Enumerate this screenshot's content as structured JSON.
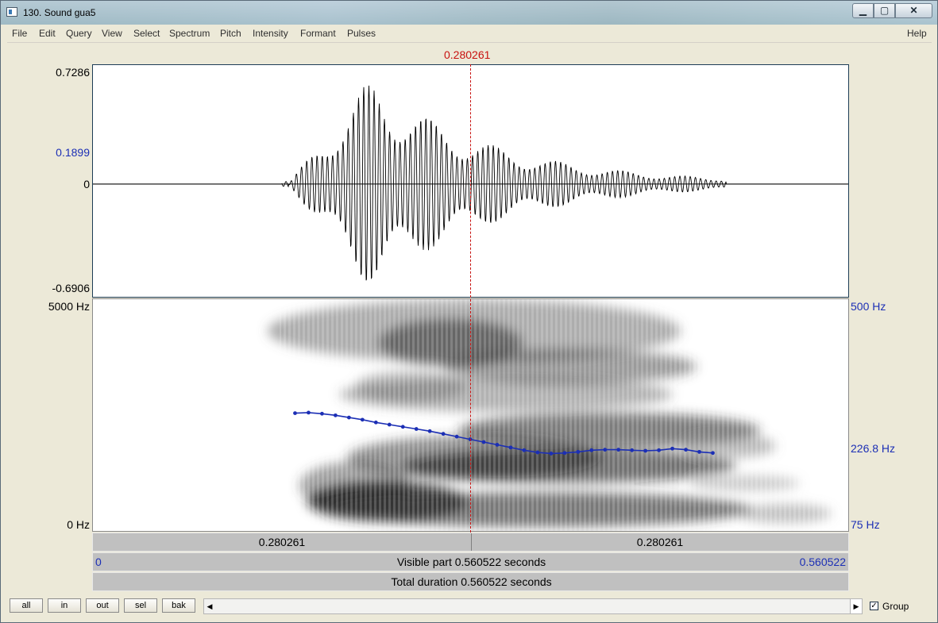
{
  "window": {
    "title": "130. Sound gua5",
    "min_glyph": "▁",
    "max_glyph": "▢",
    "close_glyph": "✕"
  },
  "menu": {
    "items": [
      "File",
      "Edit",
      "Query",
      "View",
      "Select",
      "Spectrum",
      "Pitch",
      "Intensity",
      "Formant",
      "Pulses"
    ],
    "help": "Help"
  },
  "cursor": {
    "time_label": "0.280261"
  },
  "waveform": {
    "y_max": "0.7286",
    "y_cursor": "0.1899",
    "y_zero": "0",
    "y_min": "-0.6906"
  },
  "spectrogram": {
    "freq_max": "5000 Hz",
    "freq_min": "0 Hz",
    "pitch_max": "500 Hz",
    "pitch_current": "226.8 Hz",
    "pitch_min": "75 Hz"
  },
  "timebar": {
    "left_label": "0.280261",
    "right_label": "0.280261",
    "visible_start": "0",
    "visible_label": "Visible part 0.560522 seconds",
    "visible_end": "0.560522",
    "total_label": "Total duration 0.560522 seconds"
  },
  "buttons": {
    "all": "all",
    "in": "in",
    "out": "out",
    "sel": "sel",
    "bak": "bak"
  },
  "scroll": {
    "left_glyph": "◀",
    "right_glyph": "▶"
  },
  "group": {
    "label": "Group",
    "checked": true,
    "check_glyph": "✓"
  },
  "colors": {
    "cursor": "#c8110f",
    "pitch": "#1c2fb5",
    "waveform": "#000000"
  },
  "chart_data": {
    "type": "line",
    "x_unit": "seconds",
    "x_range": [
      0,
      0.560522
    ],
    "waveform_y_range": [
      -0.6906,
      0.7286
    ],
    "pitch_range_hz": [
      75,
      500
    ],
    "pitch_series": {
      "x": [
        0.15,
        0.16,
        0.17,
        0.18,
        0.19,
        0.2,
        0.21,
        0.22,
        0.23,
        0.24,
        0.25,
        0.26,
        0.27,
        0.28,
        0.29,
        0.3,
        0.31,
        0.32,
        0.33,
        0.34,
        0.35,
        0.36,
        0.37,
        0.38,
        0.39,
        0.4,
        0.41,
        0.42,
        0.43,
        0.44,
        0.45,
        0.46
      ],
      "values": [
        291,
        292,
        290,
        287,
        283,
        279,
        274,
        270,
        266,
        262,
        258,
        253,
        248,
        243,
        238,
        233,
        228,
        223,
        219,
        217,
        218,
        220,
        223,
        224,
        224,
        223,
        222,
        223,
        226,
        224,
        220,
        218
      ]
    }
  }
}
